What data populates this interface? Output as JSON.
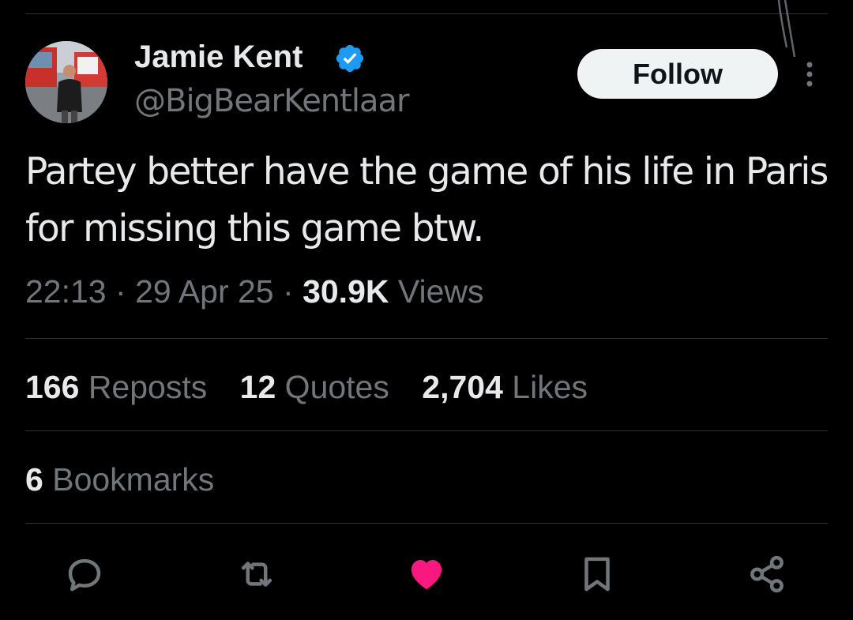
{
  "author": {
    "name": "Jamie Kent",
    "handle": "@BigBearKentlaar",
    "verified": true
  },
  "follow_label": "Follow",
  "tweet": {
    "text": "Partey better have the game of his life in Paris for missing this game btw.",
    "time": "22:13",
    "date": "29 Apr 25",
    "separator": "·",
    "views_count": "30.9K",
    "views_label": "Views"
  },
  "stats": {
    "reposts": {
      "count": "166",
      "label": "Reposts"
    },
    "quotes": {
      "count": "12",
      "label": "Quotes"
    },
    "likes": {
      "count": "2,704",
      "label": "Likes"
    },
    "bookmarks": {
      "count": "6",
      "label": "Bookmarks"
    }
  },
  "actions": [
    {
      "name": "reply",
      "icon": "reply-icon"
    },
    {
      "name": "repost",
      "icon": "repost-icon"
    },
    {
      "name": "like",
      "icon": "heart-icon",
      "active": true
    },
    {
      "name": "bookmark",
      "icon": "bookmark-icon"
    },
    {
      "name": "share",
      "icon": "share-icon"
    }
  ],
  "colors": {
    "background": "#000000",
    "text_primary": "#e7e9ea",
    "text_secondary": "#71767b",
    "divider": "#2f3336",
    "verified_blue": "#1d9bf0",
    "like_pink": "#f91880",
    "follow_button_bg": "#eff3f4"
  }
}
